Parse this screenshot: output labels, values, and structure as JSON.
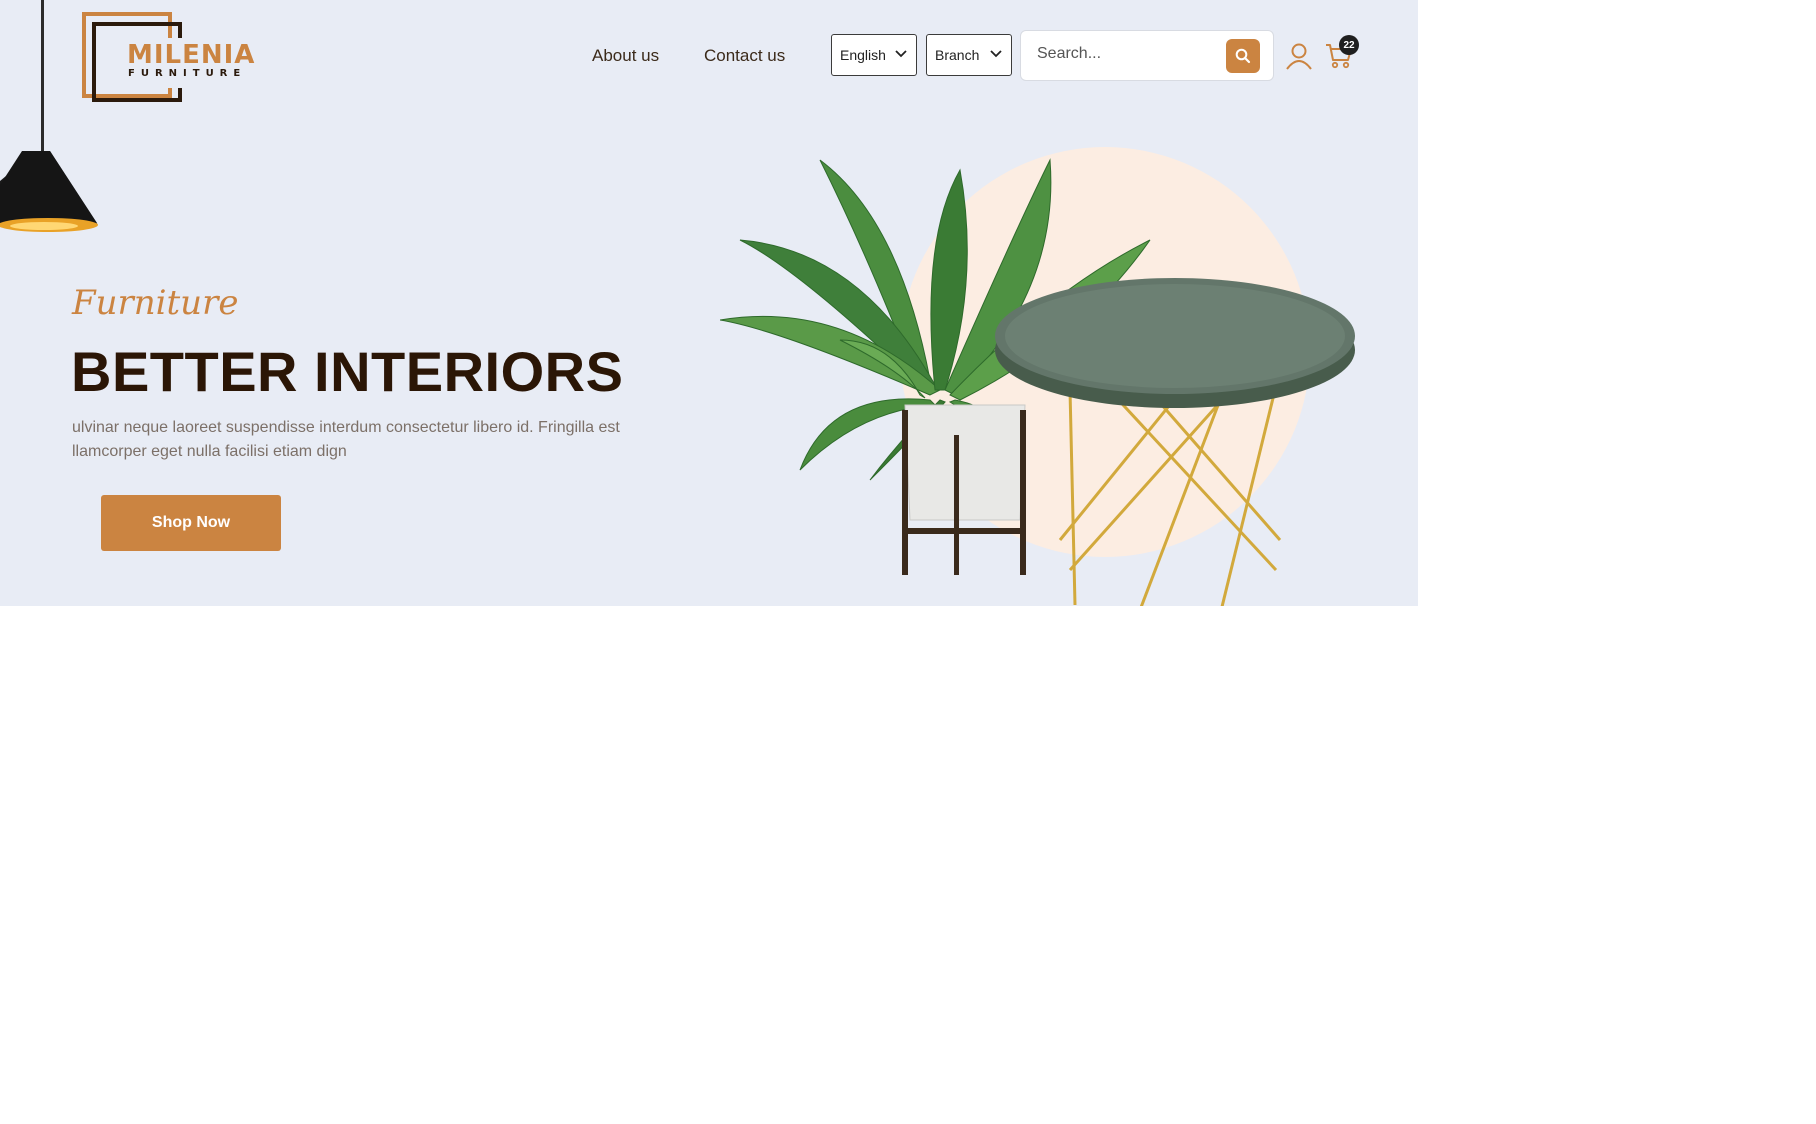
{
  "brand": {
    "name": "MILENIA",
    "tagline": "FURNITURE",
    "colors": {
      "accent": "#cb8441",
      "dark": "#2b1606",
      "hero_bg": "#e8ecf5"
    }
  },
  "nav": {
    "links": [
      {
        "label": "About us"
      },
      {
        "label": "Contact us"
      }
    ]
  },
  "language_select": {
    "value": "English"
  },
  "branch_select": {
    "value": "Branch"
  },
  "search": {
    "placeholder": "Search...",
    "icon": "search-icon"
  },
  "cart": {
    "count": "22",
    "icon": "cart-icon"
  },
  "user": {
    "icon": "user-icon"
  },
  "hero": {
    "eyebrow": "Furniture",
    "headline": "BETTER INTERIORS",
    "description": "ulvinar neque laoreet suspendisse interdum consectetur libero id. Fringilla est llamcorper eget nulla facilisi etiam dign",
    "cta_label": "Shop Now"
  }
}
